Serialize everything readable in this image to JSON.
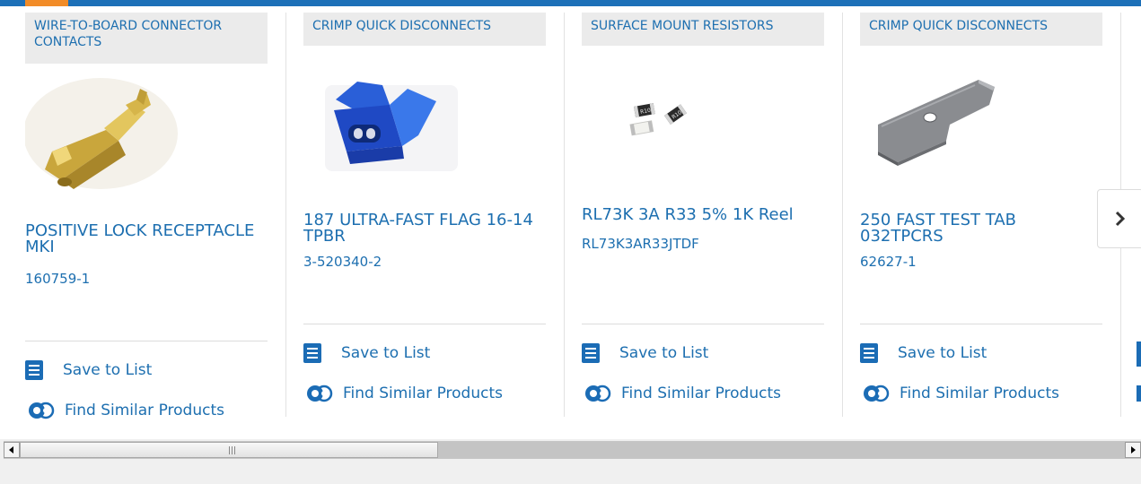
{
  "products": [
    {
      "category": "WIRE-TO-BOARD CONNECTOR CONTACTS",
      "title": "POSITIVE LOCK RECEPTACLE MKI",
      "part_number": "160759-1",
      "image": "gold-crimp-contact-image",
      "save_label": "Save to List",
      "find_label": "Find Similar Products"
    },
    {
      "category": "CRIMP QUICK DISCONNECTS",
      "title": "187 ULTRA-FAST FLAG 16-14 TPBR",
      "part_number": "3-520340-2",
      "image": "blue-flag-disconnect-image",
      "save_label": "Save to List",
      "find_label": "Find Similar Products"
    },
    {
      "category": "SURFACE MOUNT RESISTORS",
      "title": "RL73K 3A R33 5% 1K Reel",
      "part_number": "RL73K3AR33JTDF",
      "image": "smd-resistor-image",
      "chip_marking": "R10",
      "save_label": "Save to List",
      "find_label": "Find Similar Products"
    },
    {
      "category": "CRIMP QUICK DISCONNECTS",
      "title": "250 FAST TEST TAB 032TPCRS",
      "part_number": "62627-1",
      "image": "metal-test-tab-image",
      "save_label": "Save to List",
      "find_label": "Find Similar Products"
    }
  ],
  "carousel": {
    "next_icon": "chevron-right-icon"
  },
  "colors": {
    "link": "#1d6fb0",
    "accent_bar": "#1d70b8",
    "accent_orange": "#f28c28",
    "category_bg": "#ebebeb"
  }
}
